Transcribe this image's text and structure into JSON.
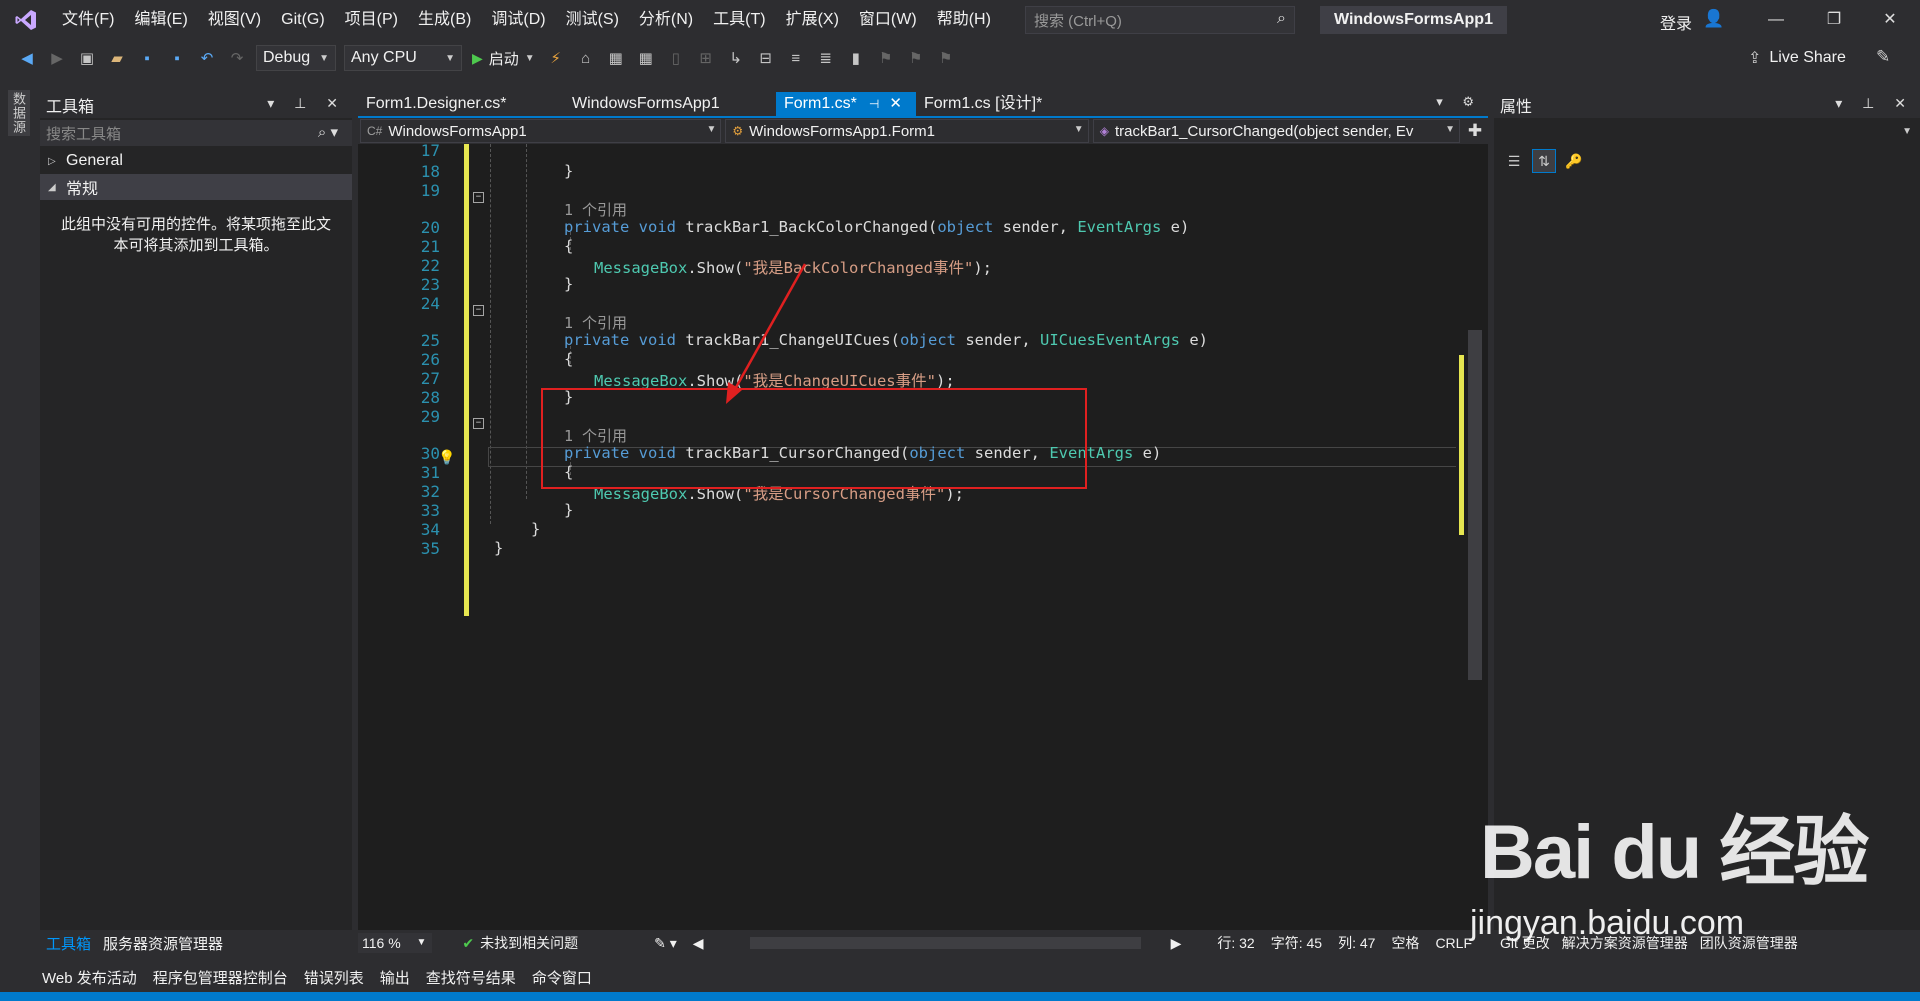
{
  "menubar": {
    "items": [
      "文件(F)",
      "编辑(E)",
      "视图(V)",
      "Git(G)",
      "项目(P)",
      "生成(B)",
      "调试(D)",
      "测试(S)",
      "分析(N)",
      "工具(T)",
      "扩展(X)",
      "窗口(W)",
      "帮助(H)"
    ],
    "search_placeholder": "搜索 (Ctrl+Q)",
    "solution_title": "WindowsFormsApp1",
    "login_label": "登录"
  },
  "toolbar": {
    "config": "Debug",
    "platform": "Any CPU",
    "run_label": "启动",
    "live_share": "Live Share"
  },
  "left_strip": {
    "label": "数据源"
  },
  "toolbox": {
    "title": "工具箱",
    "search_placeholder": "搜索工具箱",
    "groups": [
      "General",
      "常规"
    ],
    "empty_message": "此组中没有可用的控件。将某项拖至此文本可将其添加到工具箱。"
  },
  "tabs": [
    {
      "label": "Form1.Designer.cs*"
    },
    {
      "label": "WindowsFormsApp1"
    },
    {
      "label": "Form1.cs*"
    },
    {
      "label": "Form1.cs [设计]*"
    }
  ],
  "navbar": {
    "project": "WindowsFormsApp1",
    "class": "WindowsFormsApp1.Form1",
    "member": "trackBar1_CursorChanged(object sender, Ev"
  },
  "code": {
    "line_numbers": [
      "17",
      "18",
      "19",
      "20",
      "21",
      "22",
      "23",
      "24",
      "25",
      "26",
      "27",
      "28",
      "29",
      "30",
      "31",
      "32",
      "33",
      "34",
      "35"
    ],
    "reference_label": "1 个引用",
    "kw_private": "private",
    "kw_void": "void",
    "kw_object": "object",
    "messagebox": "MessageBox",
    "show_call": ".Show(",
    "methods": [
      {
        "name": "trackBar1_BackColorChanged",
        "param_type": "EventArgs",
        "message": "\"我是BackColorChanged事件\""
      },
      {
        "name": "trackBar1_ChangeUICues",
        "param_type": "UICuesEventArgs",
        "message": "\"我是ChangeUICues事件\""
      },
      {
        "name": "trackBar1_CursorChanged",
        "param_type": "EventArgs",
        "message": "\"我是CursorChanged事件\""
      }
    ],
    "sender_text": " sender, ",
    "e_text": " e)"
  },
  "properties": {
    "title": "属性"
  },
  "toolbox_tabs": [
    "工具箱",
    "服务器资源管理器"
  ],
  "statusbar": {
    "zoom": "116 %",
    "issues": "未找到相关问题",
    "line": "行: 32",
    "char": "字符: 45",
    "col": "列: 47",
    "whitespace": "空格",
    "eol": "CRLF"
  },
  "props_tabs": [
    "Git 更改",
    "解决方案资源管理器",
    "团队资源管理器"
  ],
  "bottom_tabs": [
    "Web 发布活动",
    "程序包管理器控制台",
    "错误列表",
    "输出",
    "查找符号结果",
    "命令窗口"
  ],
  "watermark": {
    "logo": "Bai du 经验",
    "url": "jingyan.baidu.com"
  },
  "colors": {
    "accent": "#007acc",
    "highlight_box": "#e02020",
    "change_bar": "#e6e650"
  }
}
